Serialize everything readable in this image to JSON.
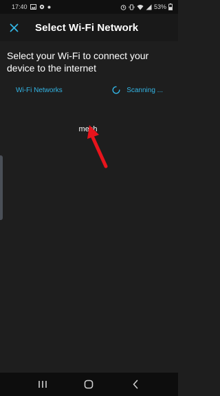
{
  "status_bar": {
    "time": "17:40",
    "battery": "53%",
    "left_icons": [
      "image-icon",
      "settings-icon",
      "dot-icon"
    ],
    "right_icons": [
      "alarm-icon",
      "vibrate-icon",
      "wifi-icon",
      "signal-icon"
    ]
  },
  "app_bar": {
    "title": "Select Wi-Fi Network",
    "close_icon": "close-icon"
  },
  "main": {
    "heading": "Select your Wi-Fi to connect your device to the internet",
    "networks_label": "Wi-Fi Networks",
    "scanning_label": "Scanning ...",
    "networks": [
      {
        "ssid": "mesh"
      }
    ]
  },
  "nav_bar": {
    "icons": [
      "recent-apps-icon",
      "home-icon",
      "back-icon"
    ]
  },
  "colors": {
    "background": "#1e1e1e",
    "accent": "#33b5e5",
    "annotation_arrow": "#e8141c"
  }
}
